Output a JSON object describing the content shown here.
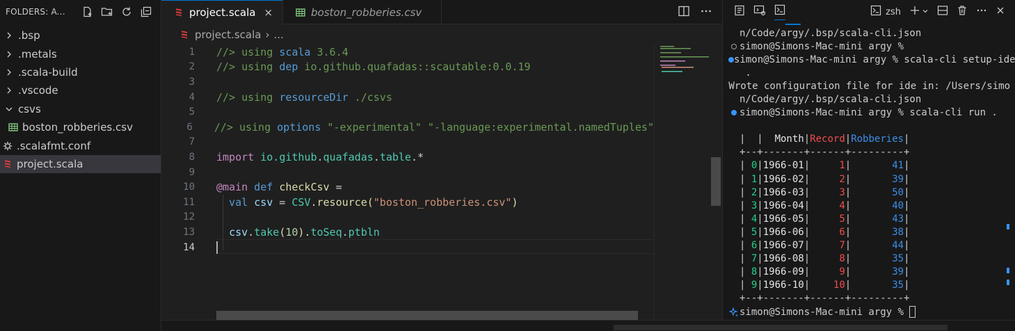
{
  "sidebar": {
    "title": "FOLDERS: A...",
    "items": [
      {
        "label": ".bsp",
        "kind": "folder",
        "expanded": false
      },
      {
        "label": ".metals",
        "kind": "folder",
        "expanded": false
      },
      {
        "label": ".scala-build",
        "kind": "folder",
        "expanded": false
      },
      {
        "label": ".vscode",
        "kind": "folder",
        "expanded": false
      },
      {
        "label": "csvs",
        "kind": "folder",
        "expanded": true
      },
      {
        "label": "boston_robberies.csv",
        "kind": "csv-file"
      },
      {
        "label": ".scalafmt.conf",
        "kind": "gear-file"
      },
      {
        "label": "project.scala",
        "kind": "scala-file",
        "selected": true
      }
    ]
  },
  "editor": {
    "tabs": [
      {
        "label": "project.scala",
        "active": true,
        "close": "×"
      },
      {
        "label": "boston_robberies.csv",
        "active": false
      }
    ],
    "breadcrumb": {
      "file": "project.scala",
      "sep": "›",
      "rest": "..."
    },
    "lines": [
      {
        "n": "1"
      },
      {
        "n": "2"
      },
      {
        "n": "3"
      },
      {
        "n": "4"
      },
      {
        "n": "5"
      },
      {
        "n": "6"
      },
      {
        "n": "7"
      },
      {
        "n": "8"
      },
      {
        "n": "9"
      },
      {
        "n": "10"
      },
      {
        "n": "11"
      },
      {
        "n": "12"
      },
      {
        "n": "13"
      },
      {
        "n": "14"
      }
    ],
    "code": {
      "l1a": "//> using ",
      "l1b": "scala",
      "l1c": " 3.6.4",
      "l2a": "//> using ",
      "l2b": "dep",
      "l2c": " io.github.quafadas",
      "l2d": "::",
      "l2e": "scautable:0.0.19",
      "l4a": "//> using ",
      "l4b": "resourceDir",
      "l4c": " ./csvs",
      "l6a": "//> using ",
      "l6b": "options",
      "l6c": " \"-experimental\" \"-language:experimental.namedTuples\"",
      "l8a": "import",
      "l8b": " io.",
      "l8c": "github",
      "l8d": ".",
      "l8e": "quafadas",
      "l8f": ".",
      "l8g": "table",
      "l8h": ".*",
      "l10a": "@",
      "l10b": "main",
      "l10c": " def ",
      "l10d": "checkCsv",
      "l10e": " =",
      "l11a": "  val ",
      "l11b": "csv",
      "l11c": " = ",
      "l11d": "CSV",
      "l11e": ".",
      "l11f": "resource",
      "l11g": "(",
      "l11h": "\"boston_robberies.csv\"",
      "l11i": ")",
      "l13a": "  ",
      "l13b": "csv",
      "l13c": ".",
      "l13d": "take",
      "l13e": "(",
      "l13f": "10",
      "l13g": ").",
      "l13h": "toSeq",
      "l13i": ".",
      "l13j": "ptbln"
    }
  },
  "terminal": {
    "shell_label": "zsh",
    "pre_lines": [
      "n/Code/argy/.bsp/scala-cli.json",
      "simon@Simons-Mac-mini argy % ",
      "simon@Simons-Mac-mini argy % scala-cli setup-ide",
      " .",
      "Wrote configuration file for ide in: /Users/simo",
      "n/Code/argy/.bsp/scala-cli.json",
      "simon@Simons-Mac-mini argy % scala-cli run ."
    ],
    "table": {
      "header": {
        "idx": "|  |",
        "month": "  Month",
        "record": "Record",
        "robberies": "Robberies"
      },
      "sep": "+--+-------+------+---------+",
      "rows": [
        {
          "i": "0",
          "month": "1966-01",
          "record": "1",
          "robberies": "41"
        },
        {
          "i": "1",
          "month": "1966-02",
          "record": "2",
          "robberies": "39"
        },
        {
          "i": "2",
          "month": "1966-03",
          "record": "3",
          "robberies": "50"
        },
        {
          "i": "3",
          "month": "1966-04",
          "record": "4",
          "robberies": "40"
        },
        {
          "i": "4",
          "month": "1966-05",
          "record": "5",
          "robberies": "43"
        },
        {
          "i": "5",
          "month": "1966-06",
          "record": "6",
          "robberies": "38"
        },
        {
          "i": "6",
          "month": "1966-07",
          "record": "7",
          "robberies": "44"
        },
        {
          "i": "7",
          "month": "1966-08",
          "record": "8",
          "robberies": "35"
        },
        {
          "i": "8",
          "month": "1966-09",
          "record": "9",
          "robberies": "39"
        },
        {
          "i": "9",
          "month": "1966-10",
          "record": "10",
          "robberies": "35"
        }
      ]
    },
    "prompt": "simon@Simons-Mac-mini argy % "
  }
}
